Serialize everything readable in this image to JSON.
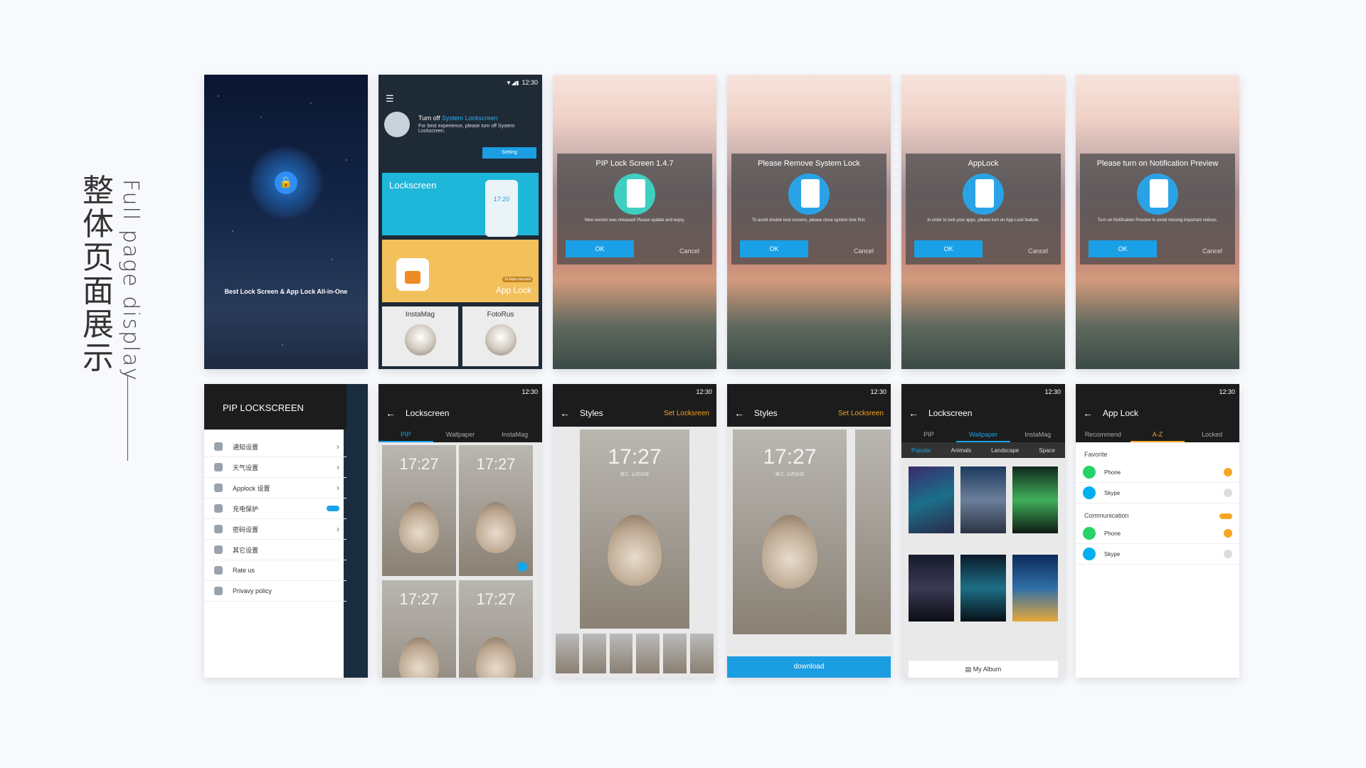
{
  "page": {
    "title_zh": [
      "整",
      "体",
      "页",
      "面",
      "展",
      "示"
    ],
    "title_en": "Full page display"
  },
  "status": {
    "time": "12:30"
  },
  "splash": {
    "tagline": "Best Lock Screen & App Lock All-in-One"
  },
  "home": {
    "turn_off": "Turn off",
    "system_lockscreen": "System Lockscreen",
    "desc": "For best experience, please turn off System Lockscreen.",
    "setting": "Setting",
    "lockscreen": "Lockscreen",
    "phone_time": "17:20",
    "apps_secured": "16 Apps secured",
    "app_lock": "App Lock",
    "instamag": "InstaMag",
    "fotorus": "FotoRus"
  },
  "dialogs": [
    {
      "title": "PIP Lock Screen  1.4.7",
      "msg": "New version was released! Please update and enjoy.",
      "ok": "OK",
      "cancel": "Cancel",
      "color": "#3ecfc1"
    },
    {
      "title": "Please Remove System Lock",
      "msg": "To avoid double lock screens, please close system lock first.",
      "ok": "OK",
      "cancel": "Cancel",
      "color": "#2aa3e6"
    },
    {
      "title": "AppLock",
      "msg": "In order to lock your apps, please turn on App Lock feature.",
      "ok": "OK",
      "cancel": "Cancel",
      "color": "#2aa3e6"
    },
    {
      "title": "Please turn on Notification Preview",
      "msg": "Turn on Notification Preview to avoid missing important notices.",
      "ok": "OK",
      "cancel": "Cancel",
      "color": "#2aa3e6"
    }
  ],
  "settings": {
    "header": "PIP LOCKSCREEN",
    "items": [
      "通知设置",
      "天气设置",
      "Applock 设置",
      "充电保护",
      "密码设置",
      "其它设置",
      "Rate us",
      "Privavy policy"
    ]
  },
  "lockscreen": {
    "title": "Lockscreen",
    "tabs": [
      "PIP",
      "Wallpaper",
      "InstaMag"
    ],
    "time": "17:27",
    "date": "周三, 11月30日"
  },
  "styles": {
    "title": "Styles",
    "action": "Set Locksreen",
    "download": "download"
  },
  "wallpaper": {
    "title": "Lockscreen",
    "tabs": [
      "PIP",
      "Wallpaper",
      "InstaMag"
    ],
    "subtabs": [
      "Popular",
      "Animals",
      "Landscape",
      "Space"
    ],
    "album": "My Album"
  },
  "applock": {
    "title": "App Lock",
    "tabs": [
      "Recommend",
      "A-Z",
      "Locked"
    ],
    "favorite": "Favorite",
    "communication": "Communication",
    "apps": [
      "Phone",
      "Skype",
      "Phone",
      "Skype"
    ]
  }
}
